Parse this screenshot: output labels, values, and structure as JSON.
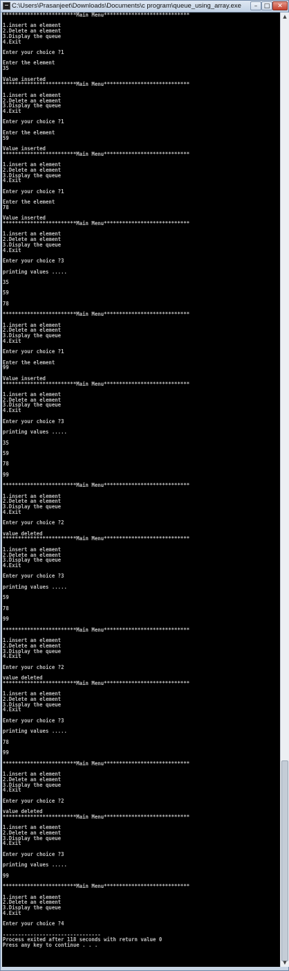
{
  "window": {
    "title": "C:\\Users\\Prasanjeet\\Downloads\\Documents\\c program\\queue_using_array.exe",
    "minimize_glyph": "–",
    "maximize_glyph": "□",
    "close_glyph": "✕",
    "app_icon": "console-app-icon"
  },
  "console": {
    "lines": [
      "************************Main Menu****************************",
      "",
      "1.insert an element",
      "2.Delete an element",
      "3.Display the queue",
      "4.Exit",
      "",
      "Enter your choice ?1",
      "",
      "Enter the element",
      "35",
      "",
      "Value inserted",
      "************************Main Menu****************************",
      "",
      "1.insert an element",
      "2.Delete an element",
      "3.Display the queue",
      "4.Exit",
      "",
      "Enter your choice ?1",
      "",
      "Enter the element",
      "59",
      "",
      "Value inserted",
      "************************Main Menu****************************",
      "",
      "1.insert an element",
      "2.Delete an element",
      "3.Display the queue",
      "4.Exit",
      "",
      "Enter your choice ?1",
      "",
      "Enter the element",
      "78",
      "",
      "Value inserted",
      "************************Main Menu****************************",
      "",
      "1.insert an element",
      "2.Delete an element",
      "3.Display the queue",
      "4.Exit",
      "",
      "Enter your choice ?3",
      "",
      "printing values .....",
      "",
      "35",
      "",
      "59",
      "",
      "78",
      "",
      "************************Main Menu****************************",
      "",
      "1.insert an element",
      "2.Delete an element",
      "3.Display the queue",
      "4.Exit",
      "",
      "Enter your choice ?1",
      "",
      "Enter the element",
      "99",
      "",
      "Value inserted",
      "************************Main Menu****************************",
      "",
      "1.insert an element",
      "2.Delete an element",
      "3.Display the queue",
      "4.Exit",
      "",
      "Enter your choice ?3",
      "",
      "printing values .....",
      "",
      "35",
      "",
      "59",
      "",
      "78",
      "",
      "99",
      "",
      "************************Main Menu****************************",
      "",
      "1.insert an element",
      "2.Delete an element",
      "3.Display the queue",
      "4.Exit",
      "",
      "Enter your choice ?2",
      "",
      "value deleted",
      "************************Main Menu****************************",
      "",
      "1.insert an element",
      "2.Delete an element",
      "3.Display the queue",
      "4.Exit",
      "",
      "Enter your choice ?3",
      "",
      "printing values .....",
      "",
      "59",
      "",
      "78",
      "",
      "99",
      "",
      "************************Main Menu****************************",
      "",
      "1.insert an element",
      "2.Delete an element",
      "3.Display the queue",
      "4.Exit",
      "",
      "Enter your choice ?2",
      "",
      "value deleted",
      "************************Main Menu****************************",
      "",
      "1.insert an element",
      "2.Delete an element",
      "3.Display the queue",
      "4.Exit",
      "",
      "Enter your choice ?3",
      "",
      "printing values .....",
      "",
      "78",
      "",
      "99",
      "",
      "************************Main Menu****************************",
      "",
      "1.insert an element",
      "2.Delete an element",
      "3.Display the queue",
      "4.Exit",
      "",
      "Enter your choice ?2",
      "",
      "value deleted",
      "************************Main Menu****************************",
      "",
      "1.insert an element",
      "2.Delete an element",
      "3.Display the queue",
      "4.Exit",
      "",
      "Enter your choice ?3",
      "",
      "printing values .....",
      "",
      "99",
      "",
      "************************Main Menu****************************",
      "",
      "1.insert an element",
      "2.Delete an element",
      "3.Display the queue",
      "4.Exit",
      "",
      "Enter your choice ?4",
      "",
      "--------------------------------",
      "Process exited after 118 seconds with return value 0",
      "Press any key to continue . . ."
    ]
  }
}
